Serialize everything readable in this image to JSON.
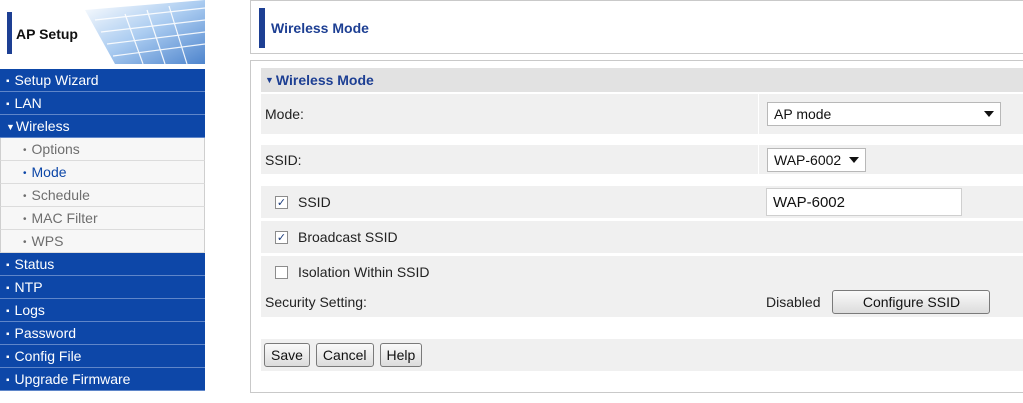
{
  "logo": {
    "title": "AP Setup"
  },
  "sidebar": {
    "items": [
      {
        "label": "Setup Wizard",
        "level": "top"
      },
      {
        "label": "LAN",
        "level": "top"
      },
      {
        "label": "Wireless",
        "level": "top",
        "expanded": true
      },
      {
        "label": "Options",
        "level": "sub"
      },
      {
        "label": "Mode",
        "level": "sub",
        "active": true
      },
      {
        "label": "Schedule",
        "level": "sub"
      },
      {
        "label": "MAC Filter",
        "level": "sub"
      },
      {
        "label": "WPS",
        "level": "sub"
      },
      {
        "label": "Status",
        "level": "top"
      },
      {
        "label": "NTP",
        "level": "top"
      },
      {
        "label": "Logs",
        "level": "top"
      },
      {
        "label": "Password",
        "level": "top"
      },
      {
        "label": "Config File",
        "level": "top"
      },
      {
        "label": "Upgrade Firmware",
        "level": "top"
      }
    ]
  },
  "header": {
    "title": "Wireless Mode"
  },
  "section": {
    "title": "Wireless Mode"
  },
  "mode": {
    "label": "Mode:",
    "value": "AP mode"
  },
  "ssid_select": {
    "label": "SSID:",
    "value": "WAP-6002"
  },
  "ssid_field": {
    "label": "SSID",
    "checked": true,
    "value": "WAP-6002"
  },
  "broadcast": {
    "label": "Broadcast SSID",
    "checked": true
  },
  "isolation": {
    "label": "Isolation Within SSID",
    "checked": false
  },
  "security": {
    "label": "Security Setting:",
    "status": "Disabled",
    "button": "Configure SSID"
  },
  "buttons": {
    "save": "Save",
    "cancel": "Cancel",
    "help": "Help"
  },
  "colors": {
    "nav_blue": "#0d47a8",
    "accent": "#1d3f93",
    "row_bg": "#f0f0f0"
  }
}
